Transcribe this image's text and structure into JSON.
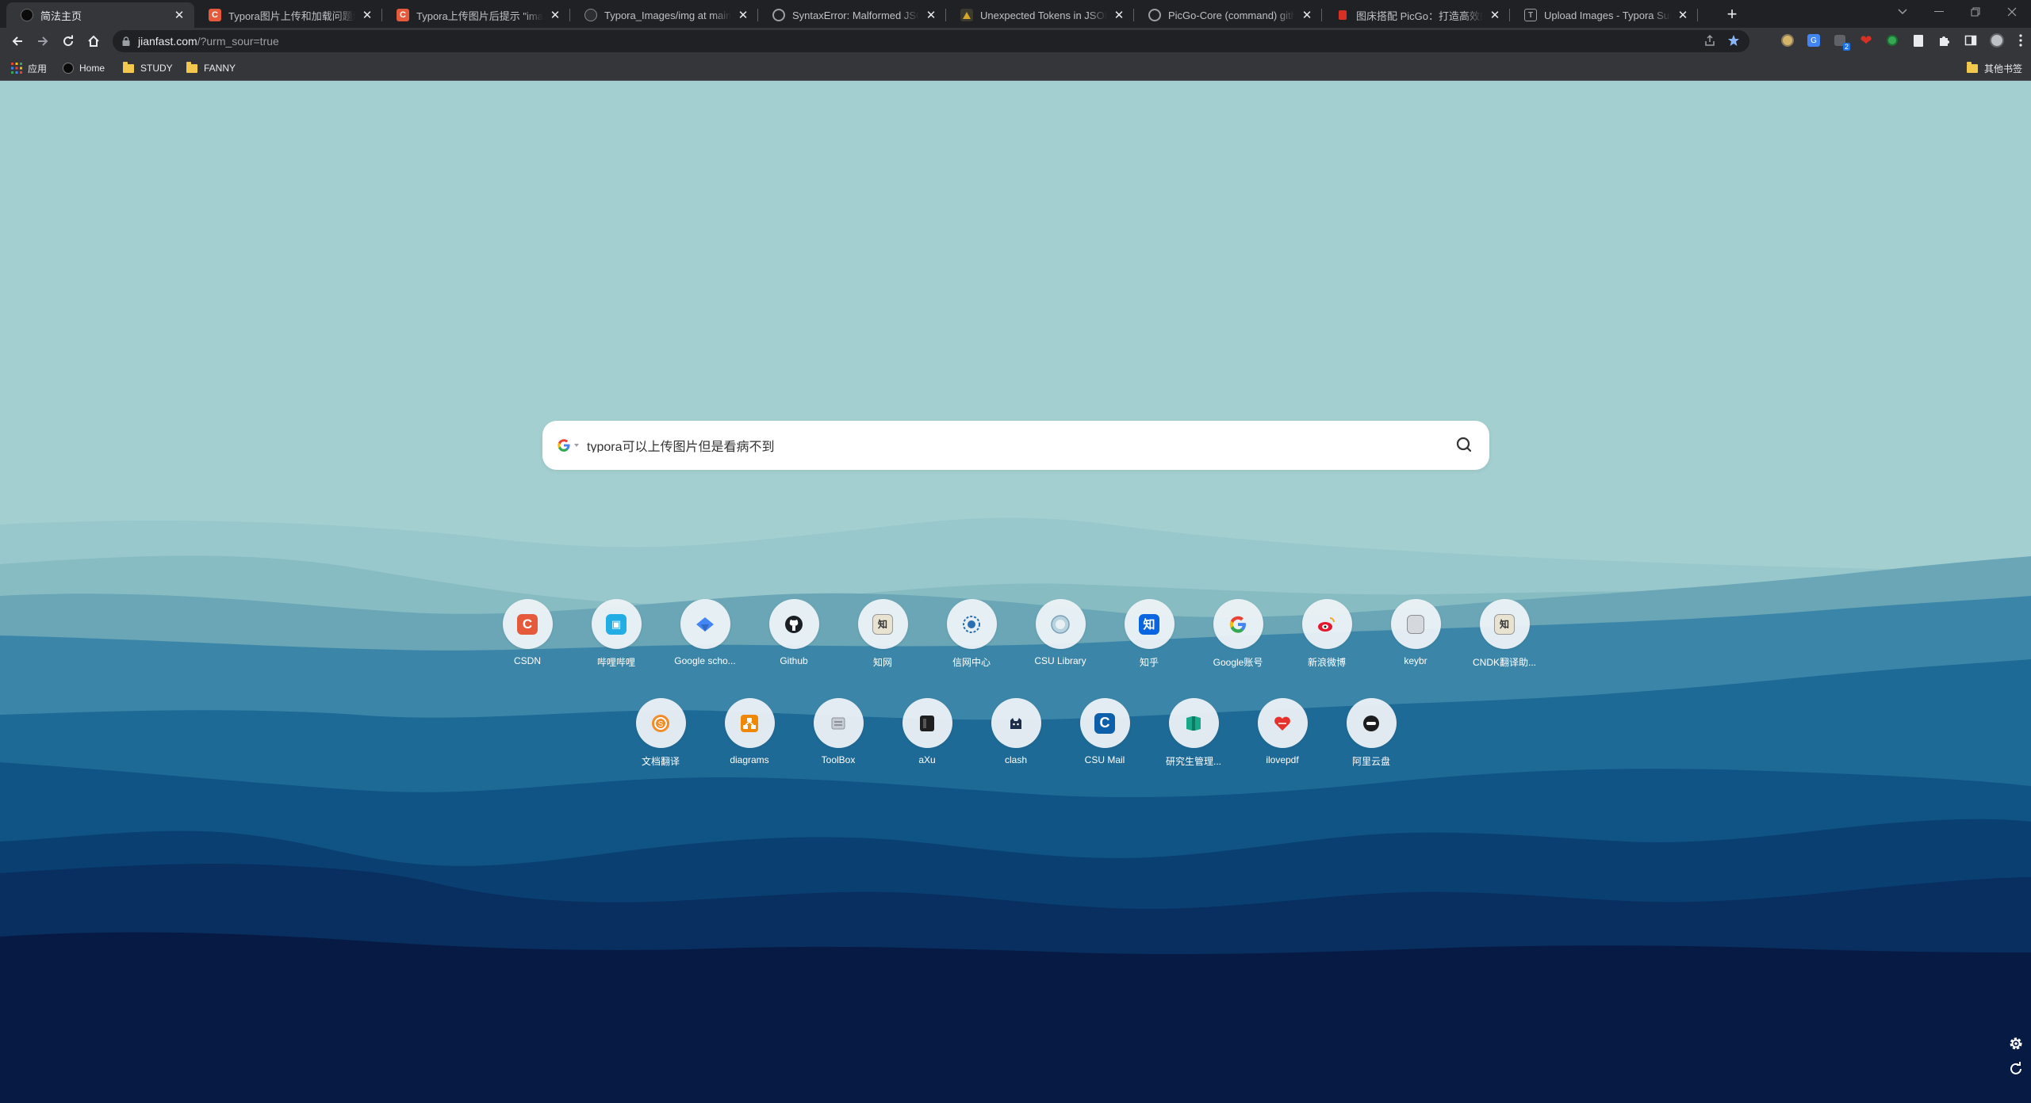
{
  "browser": {
    "tabs": [
      {
        "title": "简法主页",
        "favicon": "jianfa-icon",
        "color": "#202124"
      },
      {
        "title": "Typora图片上传和加载问题解决",
        "favicon": "csdn-icon",
        "color": "#e65a3c"
      },
      {
        "title": "Typora上传图片后提示 \"image l",
        "favicon": "csdn-icon",
        "color": "#e65a3c"
      },
      {
        "title": "Typora_Images/img at main · ",
        "favicon": "github-icon",
        "color": "#6e7681"
      },
      {
        "title": "SyntaxError: Malformed JSON",
        "favicon": "globe-icon",
        "color": "#9aa0a6"
      },
      {
        "title": "Unexpected Tokens in JSON | ",
        "favicon": "forum-icon",
        "color": "#8a6d3b"
      },
      {
        "title": "PicGo-Core (command) githul",
        "favicon": "globe-icon",
        "color": "#9aa0a6"
      },
      {
        "title": "图床搭配 PicGo：打造高效的图",
        "favicon": "red-icon",
        "color": "#d93025"
      },
      {
        "title": "Upload Images - Typora Supp",
        "favicon": "typora-icon",
        "color": "#5f6368"
      }
    ],
    "new_tab_symbol": "+",
    "close_symbol": "✕",
    "url_host": "jianfast.com",
    "url_path": "/?urm_sour=true"
  },
  "bookmarks": {
    "apps_label": "应用",
    "items": [
      "Home",
      "STUDY",
      "FANNY"
    ],
    "other_label": "其他书签"
  },
  "search": {
    "engine": "google-icon",
    "query": "typora可以上传图片但是看病不到"
  },
  "shortcuts_row1": [
    {
      "label": "CSDN",
      "icon": "csdn-icon"
    },
    {
      "label": "哔哩哔哩",
      "icon": "bilibili-icon"
    },
    {
      "label": "Google scho...",
      "icon": "google-scholar-icon"
    },
    {
      "label": "Github",
      "icon": "github-icon"
    },
    {
      "label": "知网",
      "icon": "cnki-icon"
    },
    {
      "label": "信网中心",
      "icon": "network-center-icon"
    },
    {
      "label": "CSU Library",
      "icon": "csu-library-icon"
    },
    {
      "label": "知乎",
      "icon": "zhihu-icon"
    },
    {
      "label": "Google账号",
      "icon": "google-icon"
    },
    {
      "label": "新浪微博",
      "icon": "weibo-icon"
    },
    {
      "label": "keybr",
      "icon": "keybr-icon"
    },
    {
      "label": "CNDK翻译助...",
      "icon": "cndk-icon"
    }
  ],
  "shortcuts_row2": [
    {
      "label": "文档翻译",
      "icon": "doc-translate-icon"
    },
    {
      "label": "diagrams",
      "icon": "diagrams-icon"
    },
    {
      "label": "ToolBox",
      "icon": "toolbox-icon"
    },
    {
      "label": "aXu",
      "icon": "axu-icon"
    },
    {
      "label": "clash",
      "icon": "clash-icon"
    },
    {
      "label": "CSU Mail",
      "icon": "csu-mail-icon"
    },
    {
      "label": "研究生管理...",
      "icon": "graduate-icon"
    },
    {
      "label": "ilovepdf",
      "icon": "ilovepdf-icon"
    },
    {
      "label": "阿里云盘",
      "icon": "aliyun-drive-icon"
    }
  ],
  "colors": {
    "sky": "#a3cfd0",
    "deep_sea": "#071a44",
    "chrome_dark": "#202124",
    "chrome_toolbar": "#35363a"
  }
}
